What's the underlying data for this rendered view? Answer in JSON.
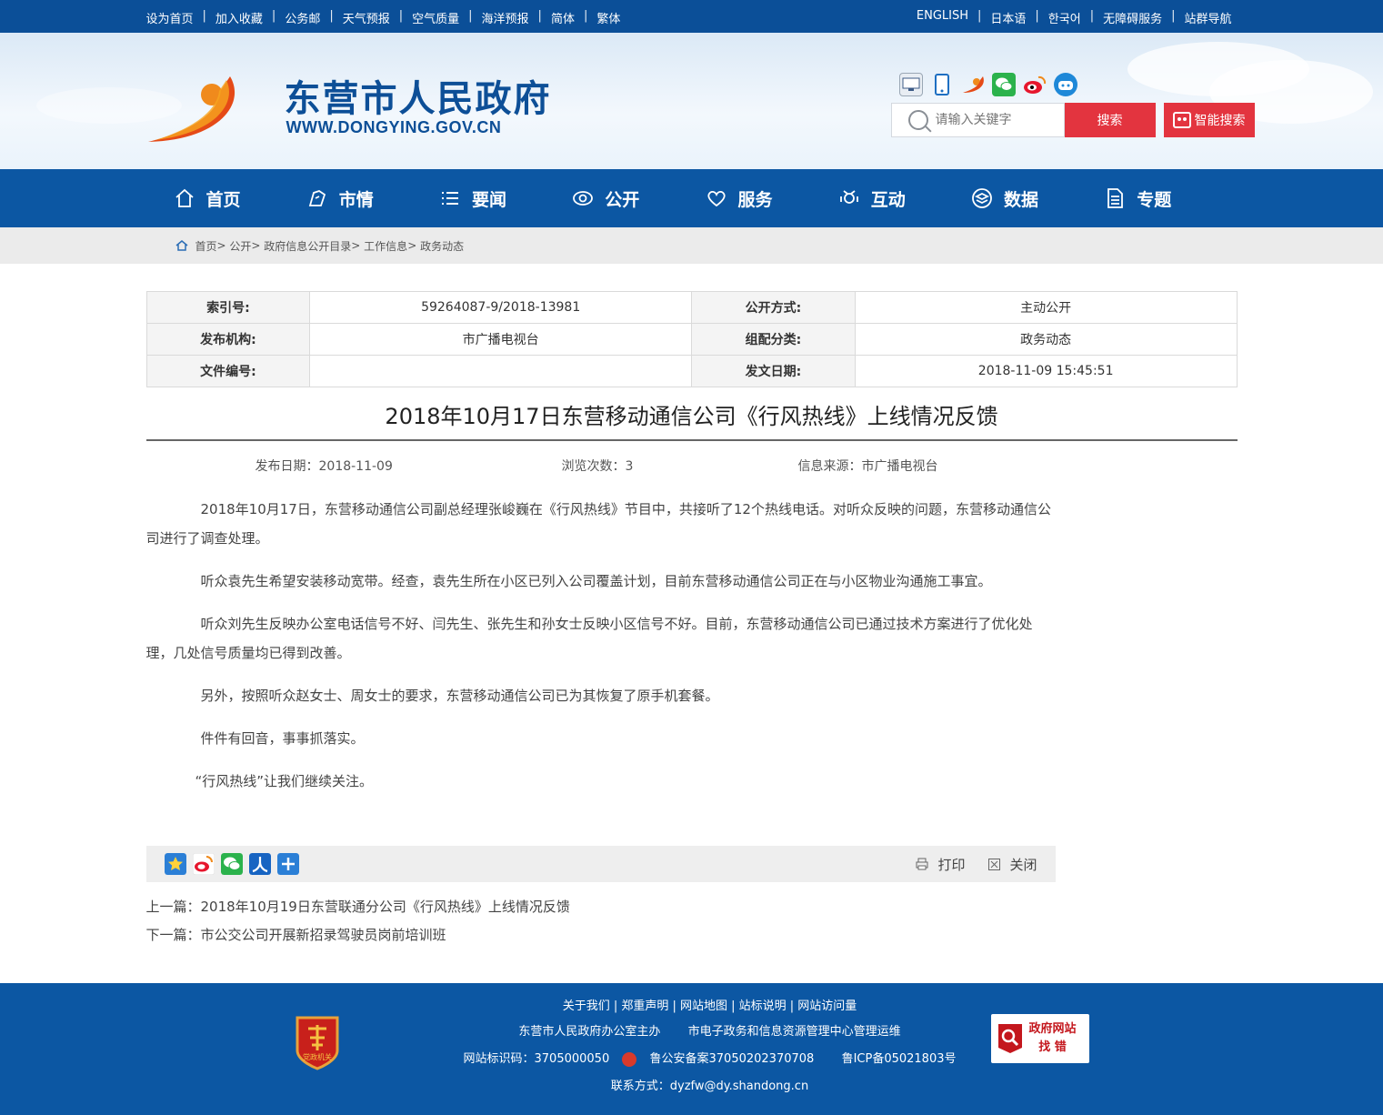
{
  "topbar": {
    "left": [
      "设为首页",
      "加入收藏",
      "公务邮",
      "天气预报",
      "空气质量",
      "海洋预报",
      "简体",
      "繁体"
    ],
    "right": [
      "ENGLISH",
      "日本语",
      "한국어",
      "无障碍服务",
      "站群导航"
    ]
  },
  "header": {
    "site_name": "东营市人民政府",
    "site_url": "WWW.DONGYING.GOV.CN",
    "social_icons": [
      "service-hall-icon",
      "mobile-icon",
      "app-icon",
      "wechat-icon",
      "weibo-icon",
      "robot-icon"
    ],
    "search_placeholder": "请输入关键字",
    "search_button": "搜索",
    "smart_search": "智能搜索"
  },
  "nav": [
    {
      "label": "首页",
      "icon": "home-icon"
    },
    {
      "label": "市情",
      "icon": "city-icon"
    },
    {
      "label": "要闻",
      "icon": "list-icon"
    },
    {
      "label": "公开",
      "icon": "eye-icon"
    },
    {
      "label": "服务",
      "icon": "heart-icon"
    },
    {
      "label": "互动",
      "icon": "interact-icon"
    },
    {
      "label": "数据",
      "icon": "data-icon"
    },
    {
      "label": "专题",
      "icon": "document-icon"
    }
  ],
  "breadcrumb": [
    "首页",
    "公开",
    "政府信息公开目录",
    "工作信息",
    "政务动态"
  ],
  "meta": {
    "index_label": "索引号:",
    "index_value": "59264087-9/2018-13981",
    "method_label": "公开方式:",
    "method_value": "主动公开",
    "org_label": "发布机构:",
    "org_value": "市广播电视台",
    "category_label": "组配分类:",
    "category_value": "政务动态",
    "docno_label": "文件编号:",
    "docno_value": "",
    "date_label": "发文日期:",
    "date_value": "2018-11-09 15:45:51"
  },
  "article": {
    "title": "2018年10月17日东营移动通信公司《行风热线》上线情况反馈",
    "publish_date": "发布日期：2018-11-09",
    "views": "浏览次数：3",
    "source": "信息来源：市广播电视台",
    "paragraphs": [
      "2018年10月17日，东营移动通信公司副总经理张峻巍在《行风热线》节目中，共接听了12个热线电话。对听众反映的问题，东营移动通信公司进行了调查处理。",
      "听众袁先生希望安装移动宽带。经查，袁先生所在小区已列入公司覆盖计划，目前东营移动通信公司正在与小区物业沟通施工事宜。",
      "听众刘先生反映办公室电话信号不好、闫先生、张先生和孙女士反映小区信号不好。目前，东营移动通信公司已通过技术方案进行了优化处理，几处信号质量均已得到改善。",
      "另外，按照听众赵女士、周女士的要求，东营移动通信公司已为其恢复了原手机套餐。",
      "件件有回音，事事抓落实。",
      "“行风热线”让我们继续关注。"
    ]
  },
  "toolbar": {
    "share_icons": [
      "favorite-icon",
      "weibo-share-icon",
      "wechat-share-icon",
      "renren-icon",
      "more-share-icon"
    ],
    "print": "打印",
    "close": "关闭"
  },
  "prevnext": {
    "prev": "上一篇：2018年10月19日东营联通分公司《行风热线》上线情况反馈",
    "next": "下一篇：市公交公司开展新招录驾驶员岗前培训班"
  },
  "footer": {
    "links": "关于我们 | 郑重声明 | 网站地图 | 站标说明 | 网站访问量",
    "host": "东营市人民政府办公室主办",
    "operator": "市电子政务和信息资源管理中心管理运维",
    "site_code": "网站标识码：3705000050",
    "police": "鲁公安备案37050202370708",
    "icp": "鲁ICP备05021803号",
    "contact": "联系方式：dyzfw@dy.shandong.cn",
    "party_badge": "党政机关",
    "gov_badge_line1": "政府网站",
    "gov_badge_line2": "找 错"
  },
  "colors": {
    "brand_blue": "#0c57a3",
    "accent_red": "#e3343f",
    "logo_orange": "#f08a1c"
  }
}
